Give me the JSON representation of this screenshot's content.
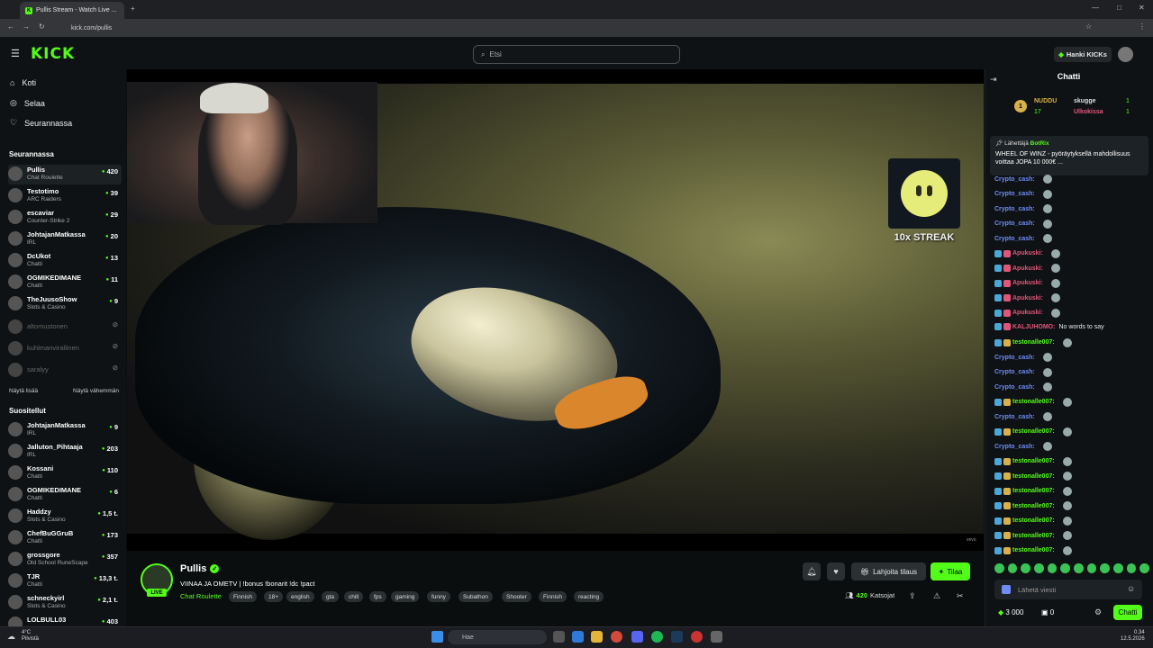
{
  "browser": {
    "tab_title": "Pullis Stream - Watch Live ...",
    "url": "kick.com/pullis"
  },
  "header": {
    "logo": "KICK",
    "search_placeholder": "Etsi",
    "kicks_button": "Hanki KICKs"
  },
  "sidebar": {
    "nav": [
      {
        "label": "Koti",
        "icon": "home-icon"
      },
      {
        "label": "Selaa",
        "icon": "browse-icon"
      },
      {
        "label": "Seurannassa",
        "icon": "heart-icon"
      }
    ],
    "following_title": "Seurannassa",
    "following": [
      {
        "name": "Pullis",
        "category": "Chat Roulette",
        "viewers": "420"
      },
      {
        "name": "Testotimo",
        "category": "ARC Raiders",
        "viewers": "39"
      },
      {
        "name": "escaviar",
        "category": "Counter-Strike 2",
        "viewers": "29"
      },
      {
        "name": "JohtajanMatkassa",
        "category": "IRL",
        "viewers": "20"
      },
      {
        "name": "DcUkot",
        "category": "Chatti",
        "viewers": "13"
      },
      {
        "name": "OGMIKEDIMANE",
        "category": "Chatti",
        "viewers": "11"
      },
      {
        "name": "TheJuusoShow",
        "category": "Slots & Casino",
        "viewers": "9"
      }
    ],
    "offline": [
      "altomustonen",
      "kuhlmanvirallinen",
      "saralyy"
    ],
    "show_more": "Näytä lisää",
    "show_less": "Näytä vähemmän",
    "recommended_title": "Suositellut",
    "recommended": [
      {
        "name": "JohtajanMatkassa",
        "category": "IRL",
        "viewers": "9"
      },
      {
        "name": "Jalluton_Pihtaaja",
        "category": "IRL",
        "viewers": "203"
      },
      {
        "name": "Kossani",
        "category": "Chatti",
        "viewers": "110"
      },
      {
        "name": "OGMIKEDIMANE",
        "category": "Chatti",
        "viewers": "6"
      },
      {
        "name": "Haddzy",
        "category": "Slots & Casino",
        "viewers": "1,5 t."
      },
      {
        "name": "ChefBuGGruB",
        "category": "Chatti",
        "viewers": "173"
      },
      {
        "name": "grossgore",
        "category": "Old School RuneScape",
        "viewers": "357"
      },
      {
        "name": "TJR",
        "category": "Chatti",
        "viewers": "13,3 t."
      },
      {
        "name": "schneckyirl",
        "category": "Slots & Casino",
        "viewers": "2,1 t."
      },
      {
        "name": "LOLBULL03",
        "category": "",
        "viewers": "403"
      }
    ]
  },
  "video": {
    "streak_text": "10x STREAK",
    "watermark": "vevo"
  },
  "stream": {
    "streamer": "Pullis",
    "live_badge": "LIVE",
    "title": "VIINAA JA OMETV | !bonus !bonarit !dc !pact",
    "category": "Chat Roulette",
    "tags": [
      "Finnish",
      "18+",
      "english",
      "gta",
      "chill",
      "fps",
      "gaming",
      "funny",
      "Subathon",
      "Shooter",
      "Finnish",
      "reacting"
    ],
    "gift_label": "Lahjoita tilaus",
    "subscribe_label": "Tilaa",
    "viewers": "420",
    "viewers_label": "Katsojat"
  },
  "chat": {
    "title": "Chatti",
    "leaderboard": [
      {
        "rank": "1",
        "name": "NUDDU",
        "count": "17"
      },
      {
        "rank": "",
        "name": "skugge",
        "count": "1"
      },
      {
        "rank": "",
        "name": "Ulkokissa",
        "count": "1"
      }
    ],
    "pinned_by_label": "Lähettäjä",
    "pinned_by": "BotRix",
    "pinned_text": "WHEEL OF WINZ - pyöräytyksellä mahdollisuus voittaa JOPA 10 000€ ...",
    "messages": [
      {
        "user": "Crypto_cash:",
        "text": "",
        "color": "#6f8cf5"
      },
      {
        "user": "Crypto_cash:",
        "text": "",
        "color": "#6f8cf5"
      },
      {
        "user": "Crypto_cash:",
        "text": "",
        "color": "#6f8cf5"
      },
      {
        "user": "Crypto_cash:",
        "text": "",
        "color": "#6f8cf5"
      },
      {
        "user": "Crypto_cash:",
        "text": "",
        "color": "#6f8cf5"
      },
      {
        "user": "Apukuski:",
        "text": "",
        "color": "#e0567a"
      },
      {
        "user": "Apukuski:",
        "text": "",
        "color": "#e0567a"
      },
      {
        "user": "Apukuski:",
        "text": "",
        "color": "#e0567a"
      },
      {
        "user": "Apukuski:",
        "text": "",
        "color": "#e0567a"
      },
      {
        "user": "Apukuski:",
        "text": "",
        "color": "#e0567a"
      },
      {
        "user": "KALJUHOMO:",
        "text": "No words to say",
        "color": "#e0567a"
      },
      {
        "user": "testonalle007:",
        "text": "",
        "color": "#53fc18"
      },
      {
        "user": "Crypto_cash:",
        "text": "",
        "color": "#6f8cf5"
      },
      {
        "user": "Crypto_cash:",
        "text": "",
        "color": "#6f8cf5"
      },
      {
        "user": "Crypto_cash:",
        "text": "",
        "color": "#6f8cf5"
      },
      {
        "user": "testonalle007:",
        "text": "",
        "color": "#53fc18"
      },
      {
        "user": "Crypto_cash:",
        "text": "",
        "color": "#6f8cf5"
      },
      {
        "user": "testonalle007:",
        "text": "",
        "color": "#53fc18"
      },
      {
        "user": "Crypto_cash:",
        "text": "",
        "color": "#6f8cf5"
      },
      {
        "user": "testonalle007:",
        "text": "",
        "color": "#53fc18"
      },
      {
        "user": "testonalle007:",
        "text": "",
        "color": "#53fc18"
      },
      {
        "user": "testonalle007:",
        "text": "",
        "color": "#53fc18"
      },
      {
        "user": "testonalle007:",
        "text": "",
        "color": "#53fc18"
      },
      {
        "user": "testonalle007:",
        "text": "",
        "color": "#53fc18"
      },
      {
        "user": "testonalle007:",
        "text": "",
        "color": "#53fc18"
      },
      {
        "user": "testonalle007:",
        "text": "",
        "color": "#53fc18"
      }
    ],
    "input_placeholder": "Lähetä viesti",
    "kicks_balance": "3 000",
    "points_balance": "0",
    "send_label": "Chatti"
  },
  "taskbar": {
    "weather_temp": "4°C",
    "weather_desc": "Pilvistä",
    "search_placeholder": "Hae",
    "time": "0.34",
    "date": "12.5.2026"
  },
  "colors": {
    "accent": "#53fc18",
    "background": "#0b0e0f",
    "panel": "#0f1214"
  }
}
